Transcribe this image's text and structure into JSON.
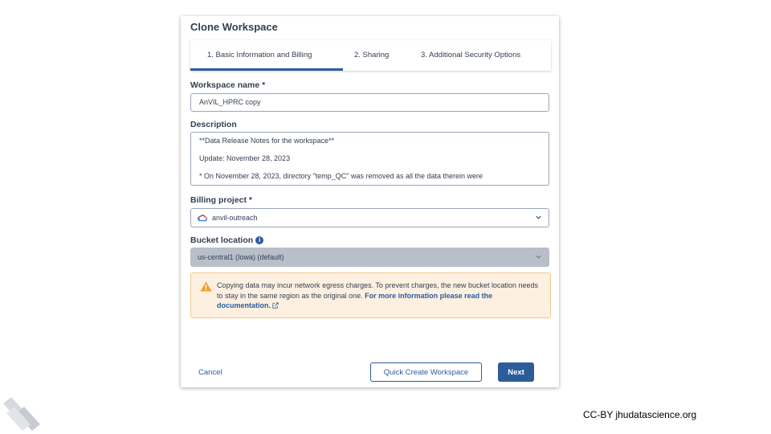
{
  "modal": {
    "title": "Clone Workspace",
    "tabs": [
      {
        "label": "1. Basic Information and Billing"
      },
      {
        "label": "2. Sharing"
      },
      {
        "label": "3. Additional Security Options"
      }
    ],
    "workspace_name": {
      "label": "Workspace name *",
      "value": "AnVIL_HPRC copy"
    },
    "description": {
      "label": "Description",
      "lines": [
        "**Data Release Notes for the workspace**",
        "Update: November 28, 2023",
        "* On November 28, 2023, directory \"temp_QC\" was removed as all the data therein were"
      ]
    },
    "billing_project": {
      "label": "Billing project *",
      "value": "anvil-outreach",
      "icon": "google-cloud-icon"
    },
    "bucket_location": {
      "label": "Bucket location",
      "value": "us-central1 (Iowa) (default)",
      "info_icon": "i"
    },
    "warning": {
      "text": "Copying data may incur network egress charges. To prevent charges, the new bucket location needs to stay in the same region as the original one.",
      "link": "For more information please read the documentation."
    },
    "buttons": {
      "cancel": "Cancel",
      "quick_create": "Quick Create Workspace",
      "next": "Next"
    }
  },
  "footer": {
    "license": "CC-BY  jhudatascience.org"
  },
  "colors": {
    "accent": "#2b5d9c",
    "warning_bg": "#fdf0e1",
    "warning_icon": "#f0a020"
  }
}
